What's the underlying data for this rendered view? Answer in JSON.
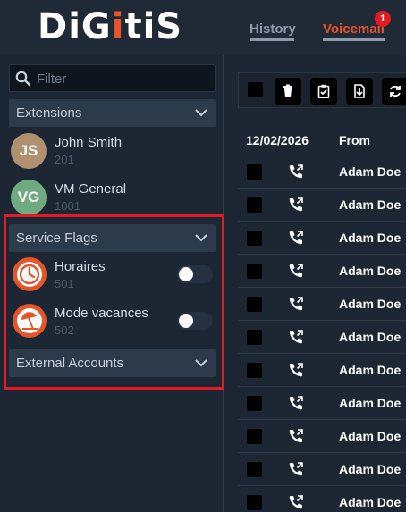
{
  "app": {
    "logo_parts": [
      "DiG",
      "i",
      "tiS"
    ]
  },
  "nav": {
    "history": "History",
    "voicemail": "Voicemail",
    "voicemail_badge": "1"
  },
  "sidebar": {
    "filter_placeholder": "Filter",
    "sections": {
      "extensions": "Extensions",
      "service_flags": "Service Flags",
      "external_accounts": "External Accounts"
    },
    "extensions": [
      {
        "initials": "JS",
        "name": "John Smith",
        "number": "201",
        "color": "#b09070"
      },
      {
        "initials": "VG",
        "name": "VM General",
        "number": "1001",
        "color": "#6faa80"
      }
    ],
    "service_flags": [
      {
        "name": "Horaires",
        "number": "501",
        "icon": "clock-icon",
        "enabled": false
      },
      {
        "name": "Mode vacances",
        "number": "502",
        "icon": "beach-umbrella-icon",
        "enabled": false
      }
    ]
  },
  "toolbar": {
    "buttons": [
      "delete-icon",
      "clipboard-check-icon",
      "download-icon",
      "refresh-icon"
    ]
  },
  "table": {
    "headers": {
      "date": "12/02/2026",
      "from": "From"
    },
    "rows": [
      {
        "from": "Adam Doe"
      },
      {
        "from": "Adam Doe"
      },
      {
        "from": "Adam Doe"
      },
      {
        "from": "Adam Doe"
      },
      {
        "from": "Adam Doe"
      },
      {
        "from": "Adam Doe"
      },
      {
        "from": "Adam Doe"
      },
      {
        "from": "Adam Doe"
      },
      {
        "from": "Adam Doe"
      },
      {
        "from": "Adam Doe"
      },
      {
        "from": "Adam Doe"
      }
    ]
  },
  "colors": {
    "accent": "#e8542a",
    "background": "#1d2733",
    "highlight": "#e01c22"
  }
}
